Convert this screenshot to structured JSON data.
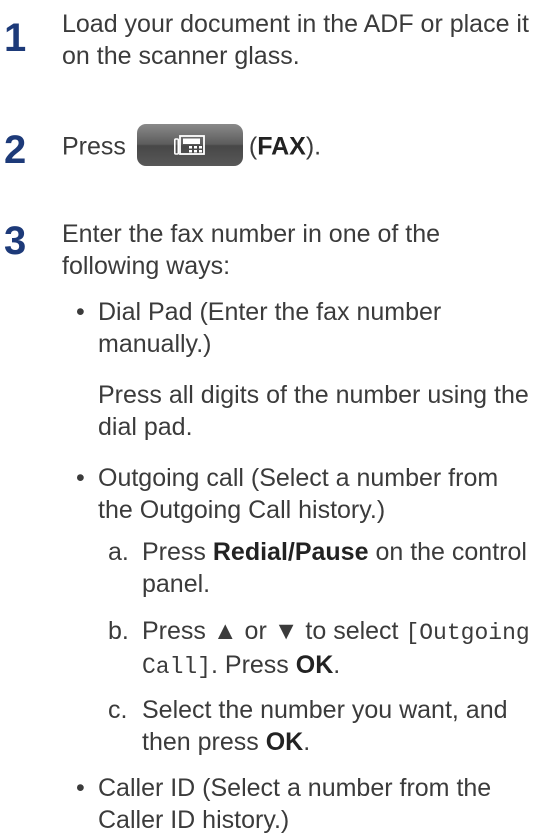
{
  "steps": [
    {
      "number": "1",
      "text": "Load your document in the ADF or place it on the scanner glass."
    },
    {
      "number": "2",
      "press": "Press",
      "button_icon": "fax-icon",
      "open_paren": "(",
      "button_label": "FAX",
      "close_paren": ")."
    },
    {
      "number": "3",
      "text": "Enter the fax number in one of the following ways:"
    }
  ],
  "options": {
    "bullet_char": "•",
    "dialpad": {
      "title": "Dial Pad (Enter the fax number manually.)",
      "detail": "Press all digits of the number using the dial pad."
    },
    "outgoing": {
      "title": "Outgoing call (Select a number from the Outgoing Call history.)",
      "a": {
        "letter": "a.",
        "pre": "Press ",
        "bold": "Redial/Pause",
        "post": " on the control panel."
      },
      "b": {
        "letter": "b.",
        "pre": "Press ▲ or ▼ to select ",
        "mono": "[Outgoing Call]",
        "mid": ". Press ",
        "bold": "OK",
        "post": "."
      },
      "c": {
        "letter": "c.",
        "pre": "Select the number you want, and then press ",
        "bold": "OK",
        "post": "."
      }
    },
    "callerid": {
      "title": "Caller ID (Select a number from the Caller ID history.)"
    }
  }
}
